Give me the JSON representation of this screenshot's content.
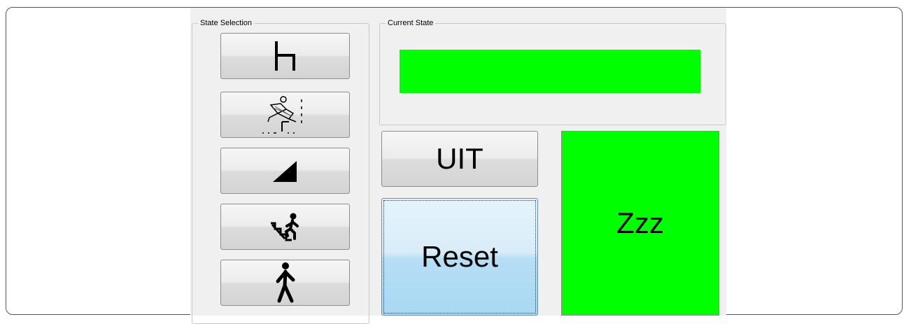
{
  "state_selection": {
    "label": "State Selection",
    "buttons": [
      {
        "icon": "chair-icon"
      },
      {
        "icon": "hurdle-jump-icon"
      },
      {
        "icon": "incline-ramp-icon"
      },
      {
        "icon": "stairs-climb-icon"
      },
      {
        "icon": "walking-person-icon"
      }
    ]
  },
  "current_state": {
    "label": "Current State",
    "indicator_color": "#00ff00"
  },
  "actions": {
    "uit_label": "UIT",
    "reset_label": "Reset"
  },
  "status": {
    "text": "Zzz",
    "color": "#00ff00"
  }
}
